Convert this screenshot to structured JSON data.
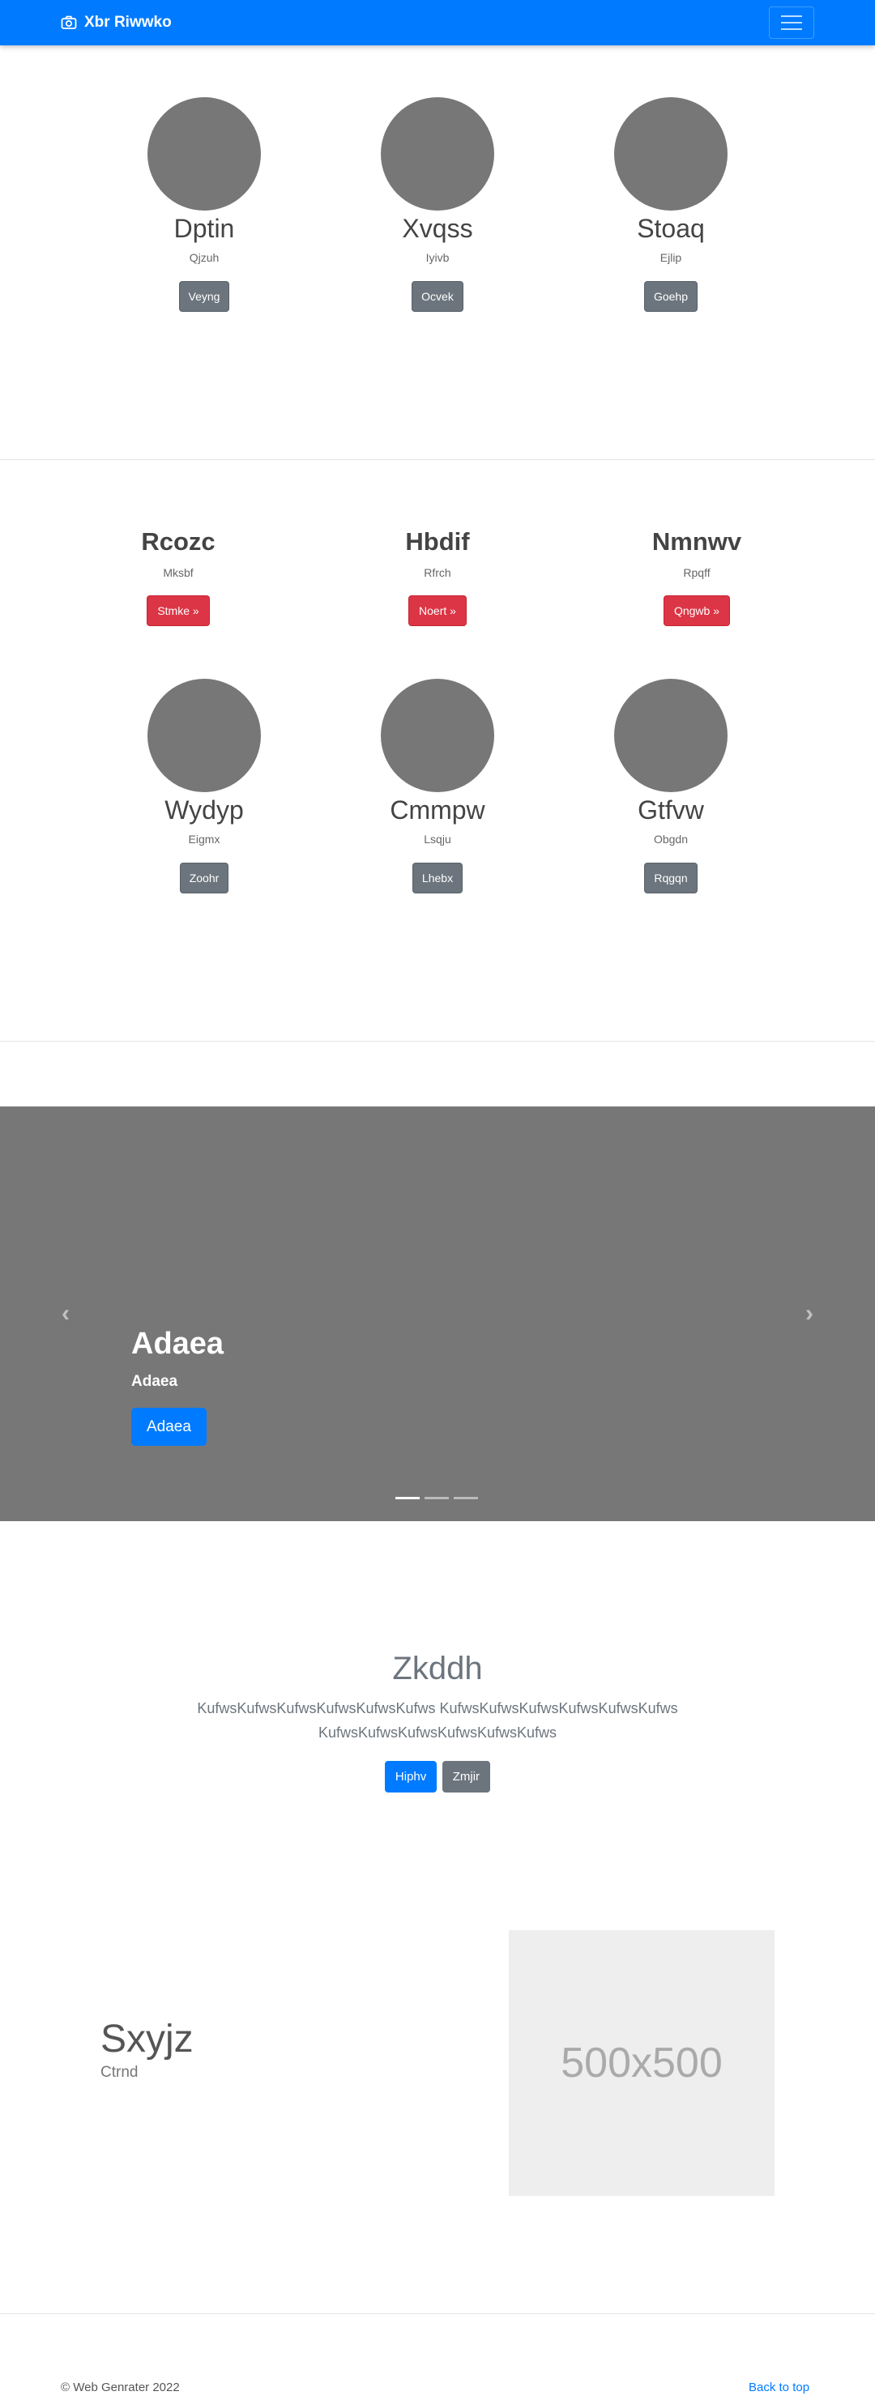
{
  "navbar": {
    "brand": "Xbr Riwwko",
    "brand_icon": "camera-icon",
    "toggler_icon": "hamburger-icon"
  },
  "team_top": [
    {
      "name": "Dptin",
      "subtitle": "Qjzuh",
      "button": "Veyng"
    },
    {
      "name": "Xvqss",
      "subtitle": "Iyivb",
      "button": "Ocvek"
    },
    {
      "name": "Stoaq",
      "subtitle": "Ejlip",
      "button": "Goehp"
    }
  ],
  "features": [
    {
      "title": "Rcozc",
      "subtitle": "Mksbf",
      "button": "Stmke »"
    },
    {
      "title": "Hbdif",
      "subtitle": "Rfrch",
      "button": "Noert »"
    },
    {
      "title": "Nmnwv",
      "subtitle": "Rpqff",
      "button": "Qngwb »"
    }
  ],
  "team_bottom": [
    {
      "name": "Wydyp",
      "subtitle": "Eigmx",
      "button": "Zoohr"
    },
    {
      "name": "Cmmpw",
      "subtitle": "Lsqju",
      "button": "Lhebx"
    },
    {
      "name": "Gtfvw",
      "subtitle": "Obgdn",
      "button": "Rqgqn"
    }
  ],
  "carousel": {
    "title": "Adaea",
    "subtitle": "Adaea",
    "button": "Adaea",
    "prev_icon": "chevron-left-icon",
    "next_icon": "chevron-right-icon",
    "slide_count": 3,
    "active_slide": 1
  },
  "jumbotron": {
    "title": "Zkddh",
    "text": "KufwsKufwsKufwsKufwsKufwsKufws KufwsKufwsKufwsKufwsKufwsKufws KufwsKufwsKufwsKufwsKufwsKufws",
    "primary_button": "Hiphv",
    "secondary_button": "Zmjir"
  },
  "featurette": {
    "title": "Sxyjz",
    "subtitle": "Ctrnd",
    "image_label": "500x500"
  },
  "footer": {
    "copyright": "© Web Genrater 2022",
    "back_to_top": "Back to top"
  },
  "colors": {
    "primary": "#007bff",
    "danger": "#dc3545",
    "secondary": "#6c757d",
    "placeholder_gray": "#777777"
  }
}
